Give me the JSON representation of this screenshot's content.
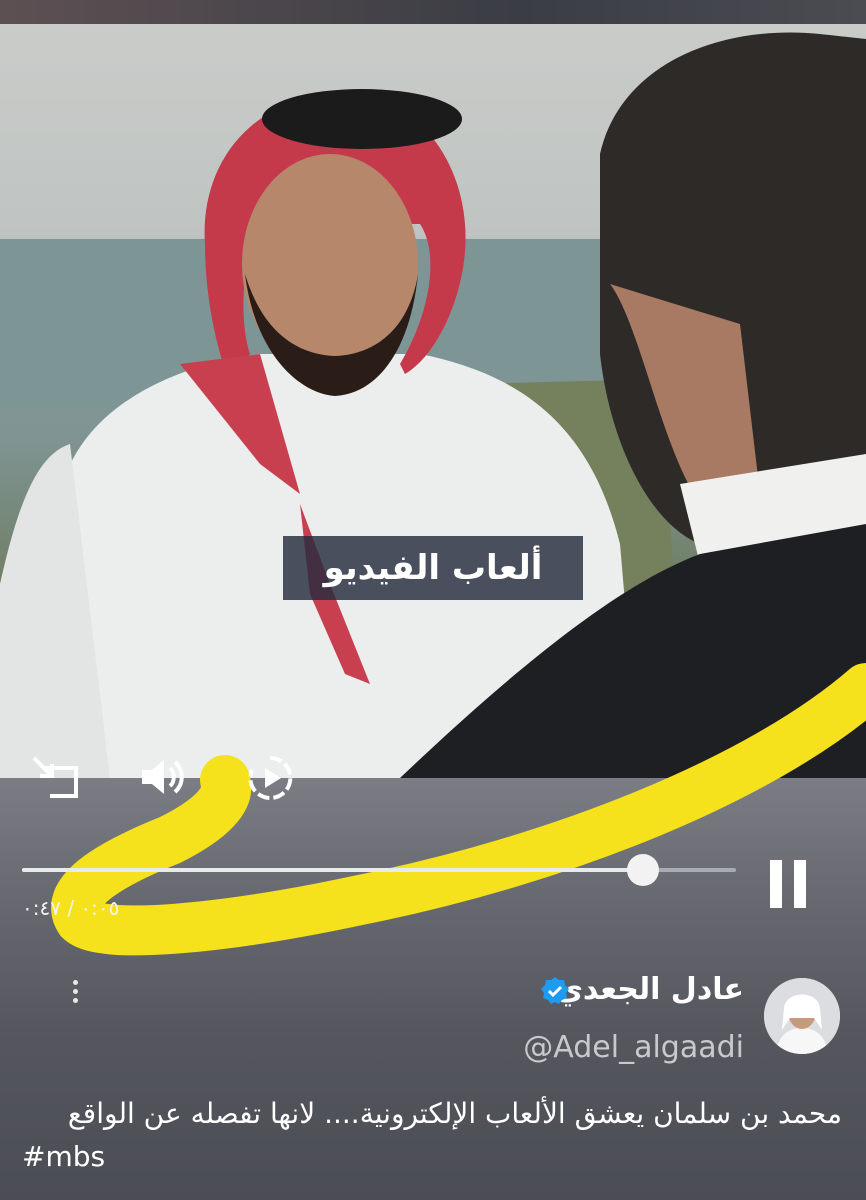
{
  "video": {
    "caption": "ألعاب الفيديو"
  },
  "controls": {
    "progress": 0.87,
    "timecode": "٠:٠٥ / ٠:٤٧"
  },
  "icons": {
    "exit_fullscreen": "exit-fullscreen-icon",
    "volume": "volume-icon",
    "replay": "replay-icon",
    "pause": "pause-icon",
    "more": "more-vertical-icon",
    "verified": "verified-badge-icon"
  },
  "tweet": {
    "author_name": "عادل الجعدي",
    "author_handle": "@Adel_algaadi",
    "text": "محمد بن سلمان يعشق الألعاب الإلكترونية.... لانها تفصله عن الواقع",
    "hashtag": "#mbs"
  },
  "colors": {
    "highlight_yellow": "#f5e11c",
    "verified_blue": "#1d9bf0"
  }
}
